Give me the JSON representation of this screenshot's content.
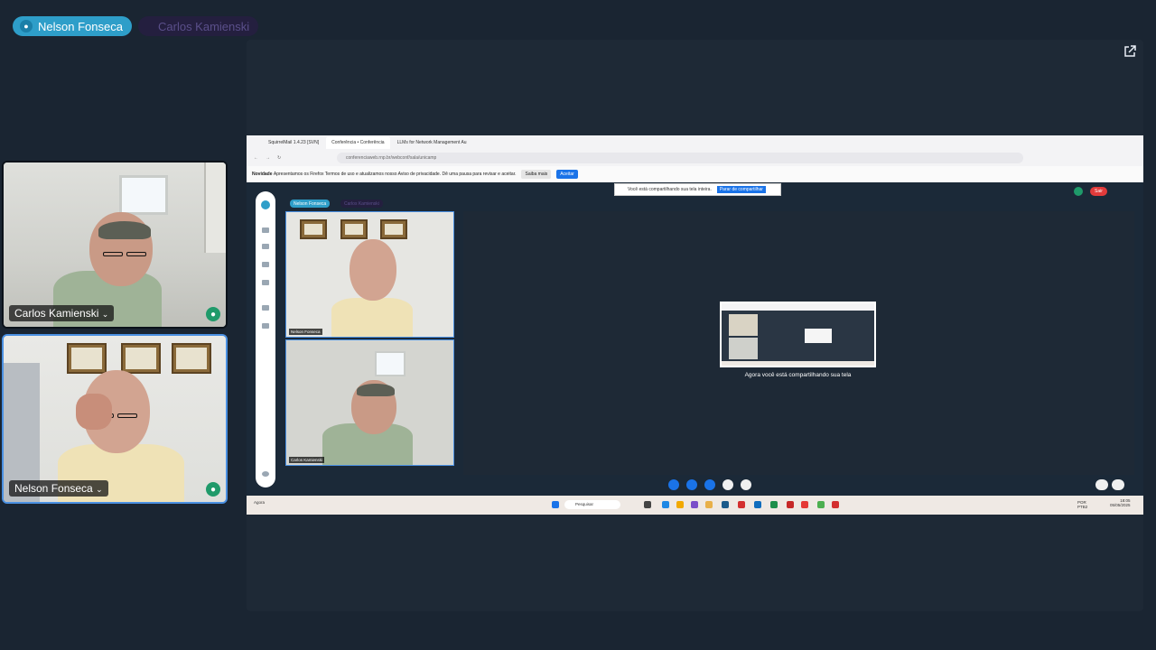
{
  "participants_bar": {
    "active_name": "Nelson Fonseca",
    "inactive_name": "Carlos Kamienski"
  },
  "tiles": [
    {
      "name": "Carlos Kamienski",
      "chevron": "⌄",
      "mic_icon": "microphone-icon"
    },
    {
      "name": "Nelson Fonseca",
      "chevron": "⌄",
      "mic_icon": "microphone-icon"
    }
  ],
  "stage": {
    "popout_icon": "external-link-icon"
  },
  "shared_screen": {
    "tabs": [
      "SquirrelMail 1.4.23 [SVN]",
      "Conferência • Conferência",
      "LLMs for Network Management Au"
    ],
    "url": "conferenciaweb.rnp.br/webconf/sala/unicamp",
    "notice_label": "Novidade",
    "notice_text": "Apresentamos os Firefox Termos de uso e atualizamos nosso Aviso de privacidade. Dê uma pausa para revisar e aceitar.",
    "notice_more": "Saiba mais",
    "notice_accept": "Aceitar",
    "share_toast": "Você está compartilhando sua tela inteira.",
    "share_stop": "Parar de compartilhar",
    "leave_button": "Sair",
    "inner_active_name": "Nelson Fonseca",
    "inner_inactive_name": "Carlos Kamienski",
    "inner_tile_labels": [
      "Nelson Fonseca",
      "Carlos Kamienski"
    ],
    "sharing_caption": "Agora você está compartilhando sua tela",
    "taskbar_weather": "Agora",
    "taskbar_search": "Pesquisar",
    "taskbar_lang": "POR PTB2",
    "taskbar_time": "18:05",
    "taskbar_date": "05/05/2025"
  },
  "colors": {
    "background": "#1a2532",
    "stage": "#1e2936",
    "accent": "#2e9ec9",
    "mic_green": "#1f9a6a",
    "selected_border": "#4a90e2",
    "leave_red": "#e23b3b"
  }
}
